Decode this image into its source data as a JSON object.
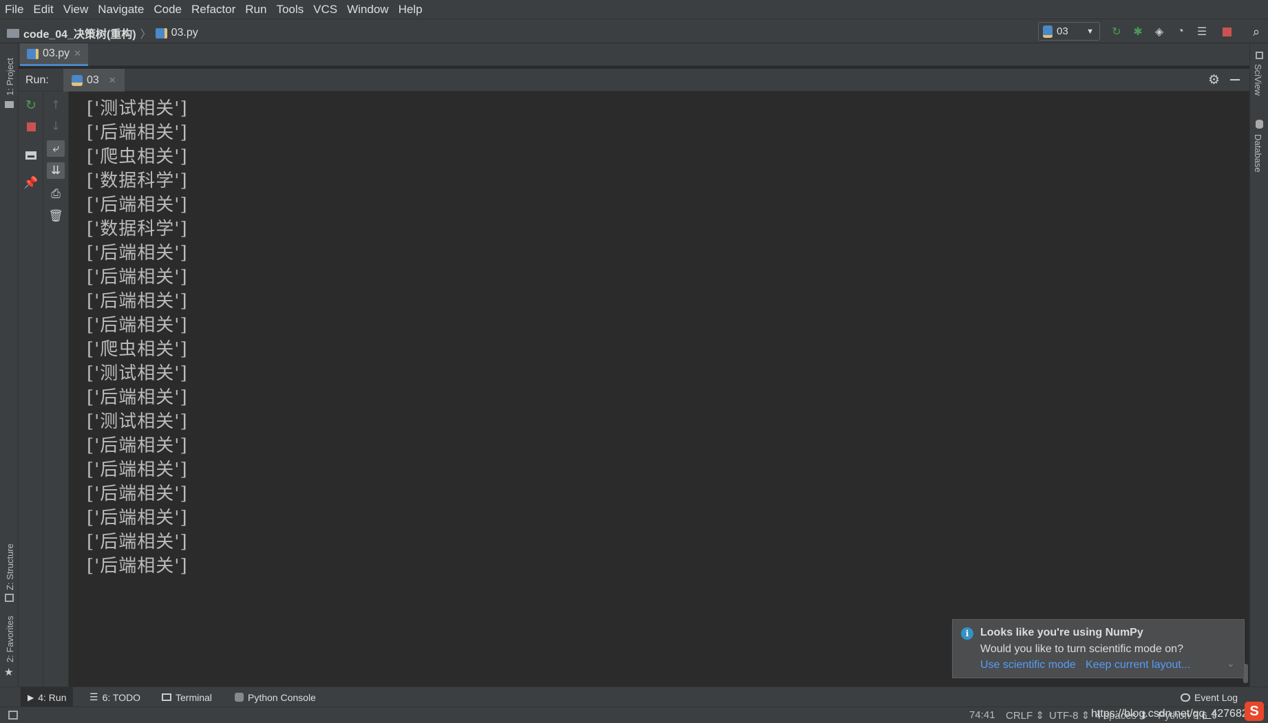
{
  "menu": [
    "File",
    "Edit",
    "View",
    "Navigate",
    "Code",
    "Refactor",
    "Run",
    "Tools",
    "VCS",
    "Window",
    "Help"
  ],
  "nav": {
    "project": "code_04_决策树(重构)",
    "file": "03.py",
    "run_config": "03"
  },
  "editor_tab": {
    "label": "03.py"
  },
  "run_panel": {
    "label": "Run:",
    "tab": "03"
  },
  "left_stripe": {
    "project": "1: Project",
    "structure": "Z: Structure",
    "favorites": "2: Favorites"
  },
  "right_stripe": {
    "sciview": "SciView",
    "database": "Database"
  },
  "console_lines": [
    "['测试相关']",
    "['后端相关']",
    "['爬虫相关']",
    "['数据科学']",
    "['后端相关']",
    "['数据科学']",
    "['后端相关']",
    "['后端相关']",
    "['后端相关']",
    "['后端相关']",
    "['爬虫相关']",
    "['测试相关']",
    "['后端相关']",
    "['测试相关']",
    "['后端相关']",
    "['后端相关']",
    "['后端相关']",
    "['后端相关']",
    "['后端相关']",
    "['后端相关']"
  ],
  "notification": {
    "title": "Looks like you're using NumPy",
    "body": "Would you like to turn scientific mode on?",
    "action1": "Use scientific mode",
    "action2": "Keep current layout..."
  },
  "bottom_tabs": {
    "run": "4: Run",
    "todo": "6: TODO",
    "terminal": "Terminal",
    "python_console": "Python Console",
    "event_log": "Event Log"
  },
  "status": {
    "position": "74:41",
    "line_sep": "CRLF ⇕",
    "encoding": "UTF-8 ⇕",
    "indent": "4 spaces ⇕",
    "interpreter": "Python 3.6 ⇕",
    "watermark": "https://blog.csdn.net/qq_427682"
  },
  "colors": {
    "accent_blue": "#4a88c7",
    "run_green": "#499c54",
    "stop_red": "#c75450",
    "link": "#589df6"
  }
}
